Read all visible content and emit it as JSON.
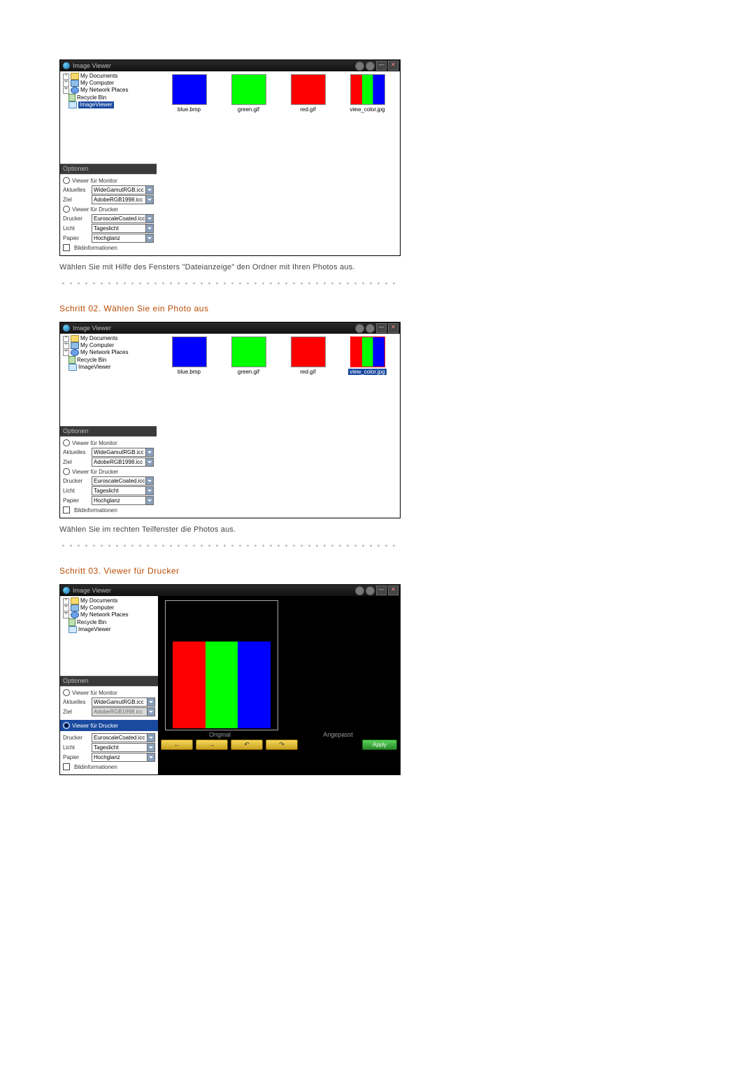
{
  "app": {
    "title": "Image Viewer"
  },
  "tree": {
    "items": [
      {
        "label": "My Documents",
        "icon": "folder"
      },
      {
        "label": "My Computer",
        "icon": "computer"
      },
      {
        "label": "My Network Places",
        "icon": "network"
      },
      {
        "label": "Recycle Bin",
        "icon": "bin"
      },
      {
        "label": "ImageViewer",
        "icon": "folder-open"
      }
    ]
  },
  "options": {
    "header": "Optionen",
    "monitor_label": "Viewer für Monitor",
    "printer_label": "Viewer für Drucker",
    "rows": {
      "aktuelles": {
        "label": "Aktuelles",
        "value": "WideGamutRGB.icc"
      },
      "ziel": {
        "label": "Ziel",
        "value": "AdobeRGB1998.icc"
      },
      "drucker": {
        "label": "Drucker",
        "value": "EuroscaleCoated.icc"
      },
      "licht": {
        "label": "Licht",
        "value": "Tageslicht"
      },
      "papier": {
        "label": "Papier",
        "value": "Hochglanz"
      }
    },
    "bildinfo": "Bildinformationen"
  },
  "thumbs": [
    {
      "name": "blue.bmp",
      "swatch": "blue"
    },
    {
      "name": "green.gif",
      "swatch": "green"
    },
    {
      "name": "red.gif",
      "swatch": "red"
    },
    {
      "name": "view_color.jpg",
      "swatch": "strip"
    }
  ],
  "preview": {
    "original": "Original",
    "angepasst": "Angepasst",
    "apply": "Apply"
  },
  "captions": {
    "c1": "Wählen Sie mit Hilfe des Fensters \"Dateianzeige\" den Ordner mit Ihren Photos aus.",
    "c2": "Wählen Sie im rechten Teilfenster die Photos aus."
  },
  "steps": {
    "s2": "Schritt 02. Wählen Sie ein Photo aus",
    "s3": "Schritt 03. Viewer für Drucker"
  }
}
